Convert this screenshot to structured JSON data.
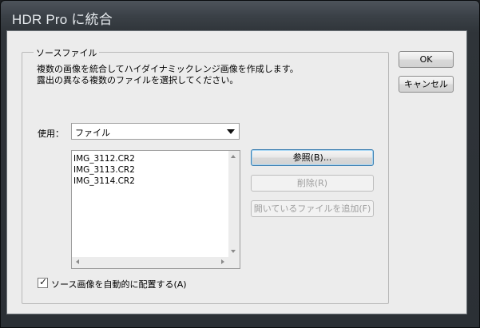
{
  "window": {
    "title": "HDR Pro に統合"
  },
  "source_group": {
    "legend": "ソースファイル",
    "description": "複数の画像を統合してハイダイナミックレンジ画像を作成します。露出の異なる複数のファイルを選択してください。"
  },
  "use_field": {
    "label": "使用：",
    "selected": "ファイル"
  },
  "file_list": [
    "IMG_3112.CR2",
    "IMG_3113.CR2",
    "IMG_3114.CR2"
  ],
  "buttons": {
    "ok": "OK",
    "cancel": "キャンセル",
    "browse": "参照(B)...",
    "remove": "削除(R)",
    "add_open_files": "開いているファイルを追加(F)"
  },
  "auto_align": {
    "label": "ソース画像を自動的に配置する(A)",
    "checked": true
  }
}
